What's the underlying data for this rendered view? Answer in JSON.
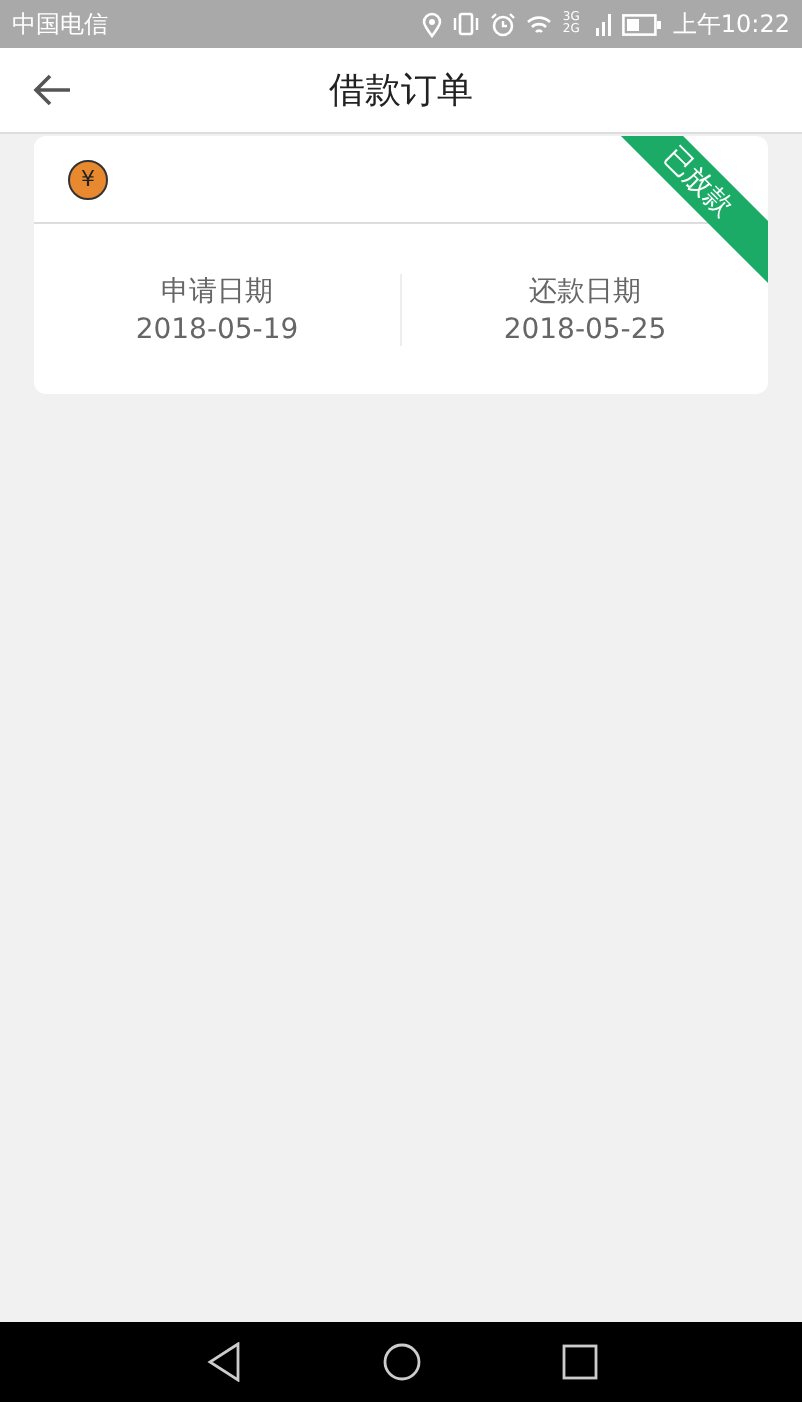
{
  "status_bar": {
    "carrier": "中国电信",
    "network": "3G 2G",
    "time": "上午10:22"
  },
  "header": {
    "title": "借款订单"
  },
  "order": {
    "currency_symbol": "¥",
    "status": "已放款",
    "dates": [
      {
        "label": "申请日期",
        "value": "2018-05-19"
      },
      {
        "label": "还款日期",
        "value": "2018-05-25"
      }
    ]
  }
}
